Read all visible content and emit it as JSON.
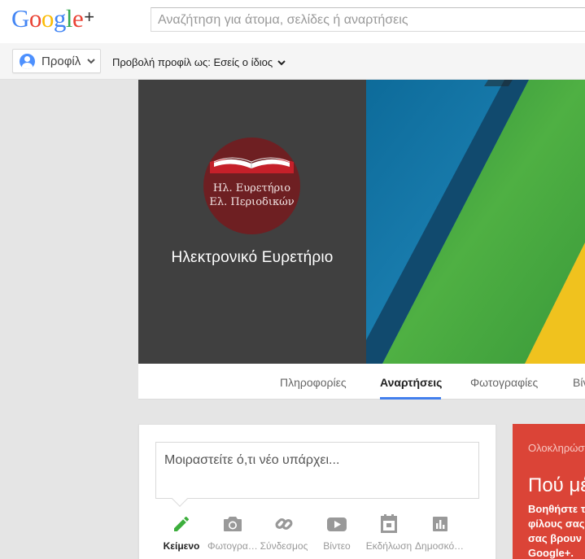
{
  "header": {
    "logo_letters": [
      {
        "ch": "G",
        "color": "#4285f4"
      },
      {
        "ch": "o",
        "color": "#ea4335"
      },
      {
        "ch": "o",
        "color": "#fbbc05"
      },
      {
        "ch": "g",
        "color": "#4285f4"
      },
      {
        "ch": "l",
        "color": "#34a853"
      },
      {
        "ch": "e",
        "color": "#ea4335"
      }
    ],
    "logo_plus": "+",
    "search_placeholder": "Αναζήτηση για άτομα, σελίδες ή αναρτήσεις"
  },
  "subbar": {
    "profile_label": "Προφίλ",
    "view_as": "Προβολή προφίλ ως: Εσείς ο ίδιος"
  },
  "profile": {
    "avatar_line1": "Ηλ. Ευρετήριο",
    "avatar_line2": "Ελ. Περιοδικών",
    "name": "Ηλεκτρονικό Ευρετήριο"
  },
  "tabs": [
    {
      "label": "Πληροφορίες",
      "active": false
    },
    {
      "label": "Αναρτήσεις",
      "active": true
    },
    {
      "label": "Φωτογραφίες",
      "active": false
    },
    {
      "label": "Βίντεο",
      "active": false
    }
  ],
  "share": {
    "placeholder": "Μοιραστείτε ό,τι νέο υπάρχει...",
    "items": [
      {
        "label": "Κείμενο",
        "icon": "pencil-icon",
        "active": true
      },
      {
        "label": "Φωτογραφίες",
        "icon": "camera-icon",
        "active": false
      },
      {
        "label": "Σύνδεσμος",
        "icon": "link-icon",
        "active": false
      },
      {
        "label": "Βίντεο",
        "icon": "video-icon",
        "active": false
      },
      {
        "label": "Εκδήλωση",
        "icon": "event-icon",
        "active": false
      },
      {
        "label": "Δημοσκόπηση",
        "icon": "poll-icon",
        "active": false
      }
    ]
  },
  "promo": {
    "heading": "Ολοκληρώστε",
    "title": "Πού μένετε;",
    "body": "Βοηθήστε τους φίλους σας να σας βρουν στο Google+."
  },
  "colors": {
    "accent_blue": "#427fed",
    "promo_red": "#db4437",
    "active_green": "#3cae3c"
  }
}
